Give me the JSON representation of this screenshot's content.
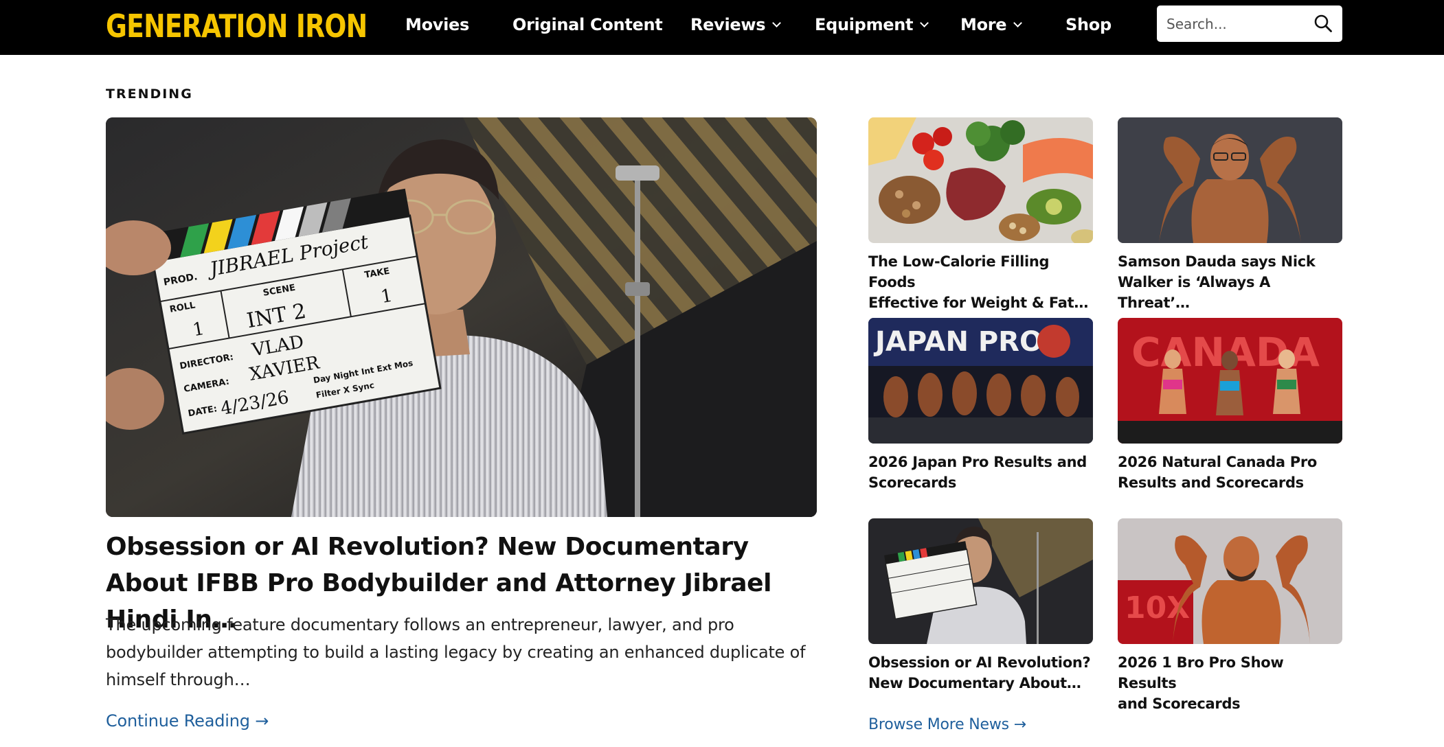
{
  "site": {
    "logo_text": "GENERATION IRON",
    "brand_color": "#f6c500",
    "header_bg": "#000000",
    "link_color": "#1f5f9c"
  },
  "nav": {
    "items": [
      {
        "label": "Movies",
        "has_dropdown": false
      },
      {
        "label": "Original Content",
        "has_dropdown": false
      },
      {
        "label": "Reviews",
        "has_dropdown": true
      },
      {
        "label": "Equipment",
        "has_dropdown": true
      },
      {
        "label": "More",
        "has_dropdown": true
      },
      {
        "label": "Shop",
        "has_dropdown": false
      }
    ]
  },
  "search": {
    "placeholder": "Search...",
    "icon": "search-icon"
  },
  "trending": {
    "label": "TRENDING",
    "hero": {
      "title": "Obsession or AI Revolution? New Documentary About IFBB Pro Bodybuilder and Attorney Jibrael Hindi In…",
      "excerpt": "The upcoming feature documentary follows an entrepreneur, lawyer, and pro bodybuilder attempting to build a lasting legacy by creating an enhanced duplicate of himself through…",
      "link_label": "Continue Reading →",
      "slate": {
        "prod": "PROD.",
        "prod_value": "JIBRAEL Project",
        "roll": "ROLL",
        "roll_value": "1",
        "scene": "SCENE",
        "scene_value": "INT 2",
        "take": "TAKE",
        "take_value": "1",
        "director": "DIRECTOR:",
        "director_value": "VLAD",
        "camera": "CAMERA:",
        "camera_value": "XAVIER",
        "date": "DATE:",
        "date_value": "4/23/26",
        "modes": "Day Night Int Ext Mos",
        "filter": "Filter X  Sync"
      }
    },
    "cards": [
      {
        "title_line1": "The Low-Calorie Filling Foods",
        "title_line2": "Effective for Weight & Fat…",
        "image": "healthy-food"
      },
      {
        "title_line1": "Samson Dauda says Nick",
        "title_line2": "Walker is ‘Always A Threat’…",
        "image": "bodybuilder-pose"
      },
      {
        "title_line1": "2026 Japan Pro Results and",
        "title_line2": "Scorecards",
        "image": "japan-pro-stage",
        "banner_text": "JAPAN PRO"
      },
      {
        "title_line1": "2026 Natural Canada Pro",
        "title_line2": "Results and Scorecards",
        "image": "canada-pro-stage",
        "banner_text": "CANADA"
      },
      {
        "title_line1": "Obsession or AI Revolution?",
        "title_line2": "New Documentary About…",
        "image": "slate-thumb"
      },
      {
        "title_line1": "2026 1 Bro Pro Show Results",
        "title_line2": "and Scorecards",
        "image": "bro-pro-pose",
        "banner_text": "10X"
      }
    ],
    "browse_label": "Browse More News →"
  }
}
